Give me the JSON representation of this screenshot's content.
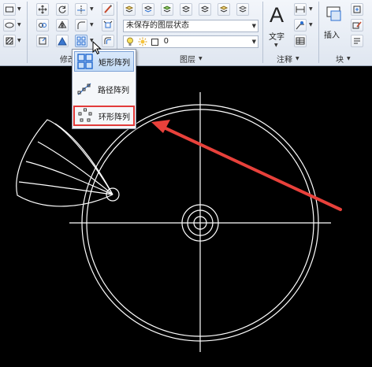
{
  "ribbon": {
    "modify_panel_label": "修改",
    "layers_panel_label": "图层",
    "annotation_panel_label": "注释",
    "block_panel_label": "块",
    "layer_state_combo": "未保存的图层状态",
    "layer_combo": "0",
    "text_button_label": "文字",
    "insert_button_label": "插入"
  },
  "array_dropdown": {
    "items": [
      {
        "label": "矩形阵列",
        "icon": "rect-array-icon"
      },
      {
        "label": "路径阵列",
        "icon": "path-array-icon"
      },
      {
        "label": "环形阵列",
        "icon": "polar-array-icon"
      }
    ]
  },
  "colors": {
    "canvas": "#000000",
    "geometry": "#ffffff",
    "highlight_box": "#e23b3b",
    "arrow": "#e8413b"
  }
}
